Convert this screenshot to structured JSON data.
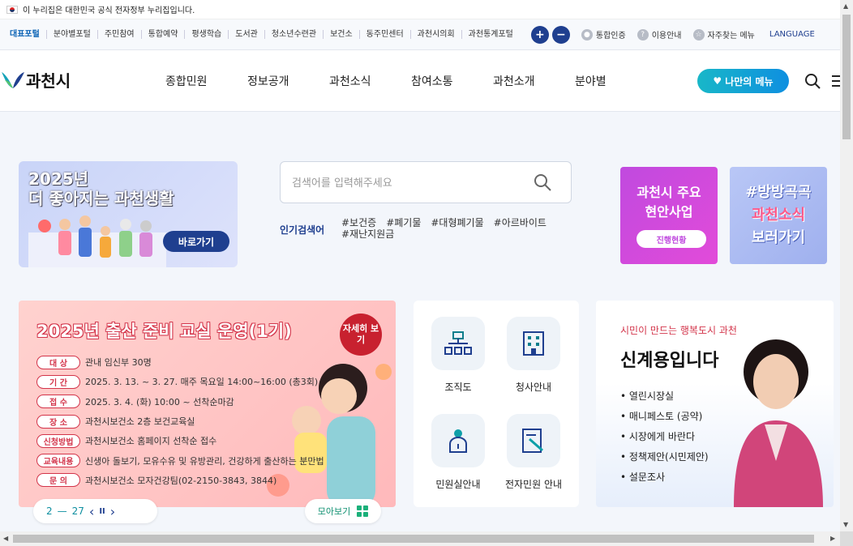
{
  "topbar": {
    "notice": "이 누리집은 대한민국 공식 전자정부 누리집입니다."
  },
  "sites": [
    "대표포털",
    "분야별포털",
    "주민참여",
    "통합예약",
    "평생학습",
    "도서관",
    "청소년수련관",
    "보건소",
    "동주민센터",
    "과천시의회",
    "과천통계포털"
  ],
  "util": {
    "zoom_in": "+",
    "zoom_out": "−",
    "auth": "통합인증",
    "guide": "이용안내",
    "favorites": "자주찾는 메뉴",
    "language": "LANGUAGE"
  },
  "logo": {
    "text": "과천시"
  },
  "gnb": [
    "종합민원",
    "정보공개",
    "과천소식",
    "참여소통",
    "과천소개",
    "분야별"
  ],
  "my_menu": "나만의 메뉴",
  "banner1": {
    "line1": "2025년",
    "line2": "더 좋아지는 과천생활",
    "button": "바로가기"
  },
  "search": {
    "placeholder": "검색어를 입력해주세요",
    "popular_label": "인기검색어",
    "tags": [
      "#보건증",
      "#폐기물",
      "#대형폐기물",
      "#아르바이트",
      "#재난지원금"
    ]
  },
  "promo1": {
    "line1": "과천시 주요",
    "line2": "현안사업",
    "button": "진행현황"
  },
  "promo2": {
    "line1": "#방방곡곡",
    "line2": "과천소식",
    "line3": "보러가기"
  },
  "event": {
    "title": "2025년 출산 준비 교실 운영(1기)",
    "detail": "자세히 보기",
    "rows": [
      {
        "label": "대 상",
        "value": "관내 임신부 30명"
      },
      {
        "label": "기 간",
        "value": "2025. 3. 13. ~ 3. 27. 매주 목요일 14:00~16:00 (총3회)"
      },
      {
        "label": "접 수",
        "value": "2025. 3. 4. (화) 10:00 ~ 선착순마감"
      },
      {
        "label": "장 소",
        "value": "과천시보건소 2층 보건교육실"
      },
      {
        "label": "신청방법",
        "value": "과천시보건소 홈페이지 선착순 접수"
      },
      {
        "label": "교육내용",
        "value": "신생아 돌보기, 모유수유 및 유방관리, 건강하게 출산하는 분만법"
      },
      {
        "label": "문 의",
        "value": "과천시보건소 모자건강팀(02-2150-3843, 3844)"
      }
    ],
    "pager": {
      "current": "2",
      "sep": "—",
      "total": "27"
    },
    "more": "모아보기"
  },
  "quick": [
    "조직도",
    "청사안내",
    "민원실안내",
    "전자민원 안내"
  ],
  "mayor": {
    "slogan": "시민이 만드는 행복도시 과천",
    "name": "신계용입니다",
    "items": [
      "• 열린시장실",
      "• 매니페스토 (공약)",
      "• 시장에게 바란다",
      "• 정책제안(시민제안)",
      "• 설문조사"
    ]
  }
}
